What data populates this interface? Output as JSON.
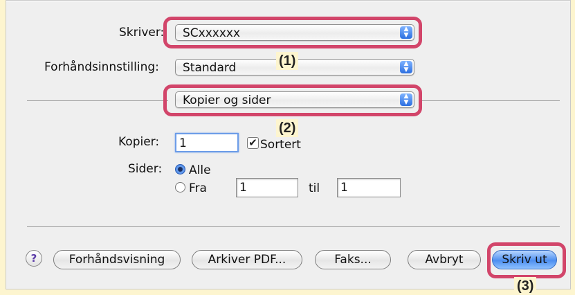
{
  "printer": {
    "label": "Skriver:",
    "value": "SCxxxxxx"
  },
  "preset": {
    "label": "Forhåndsinnstilling:",
    "value": "Standard"
  },
  "panel_menu": {
    "value": "Kopier og sider"
  },
  "copies": {
    "label": "Kopier:",
    "value": "1",
    "collate_label": "Sortert",
    "collate_checked": true
  },
  "pages": {
    "label": "Sider:",
    "all_label": "Alle",
    "from_label": "Fra",
    "from_value": "1",
    "to_label": "til",
    "to_value": "1",
    "selected": "all"
  },
  "buttons": {
    "help": "?",
    "preview": "Forhåndsvisning",
    "save_pdf": "Arkiver PDF...",
    "fax": "Faks...",
    "cancel": "Avbryt",
    "print": "Skriv ut"
  },
  "callouts": {
    "c1": "(1)",
    "c2": "(2)",
    "c3": "(3)"
  },
  "colors": {
    "highlight": "#d2456a",
    "background": "#fdf5cf",
    "accent": "#3f78da"
  }
}
